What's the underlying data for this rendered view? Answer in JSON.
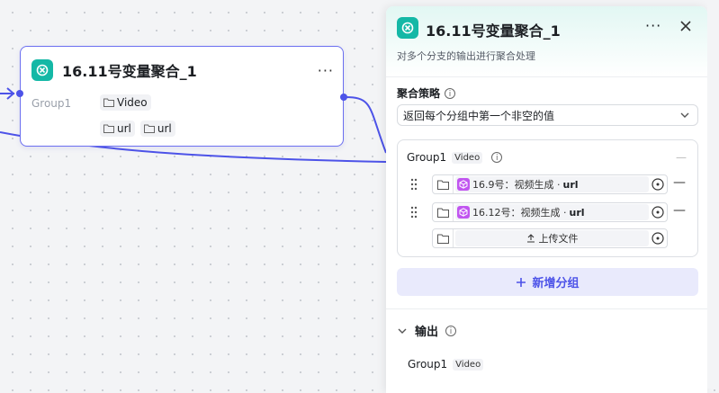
{
  "node": {
    "title": "16.11号变量聚合_1",
    "more": "···",
    "group_label": "Group1",
    "tags": [
      "Video",
      "url",
      "url"
    ]
  },
  "panel": {
    "title": "16.11号变量聚合_1",
    "more": "···",
    "description": "对多个分支的输出进行聚合处理",
    "strategy_label": "聚合策略",
    "strategy_value": "返回每个分组中第一个非空的值",
    "group": {
      "name": "Group1",
      "type": "Video",
      "refs": [
        {
          "prefix": "16.9号：视频生成 · ",
          "var": "url"
        },
        {
          "prefix": "16.12号：视频生成 · ",
          "var": "url"
        }
      ],
      "upload_label": "上传文件"
    },
    "add_group_label": "新增分组",
    "output_label": "输出",
    "output_group": {
      "name": "Group1",
      "type": "Video"
    }
  },
  "colors": {
    "accent": "#4d53e8",
    "node_icon": "#14b8a6",
    "ref_icon": "#c155f0"
  }
}
